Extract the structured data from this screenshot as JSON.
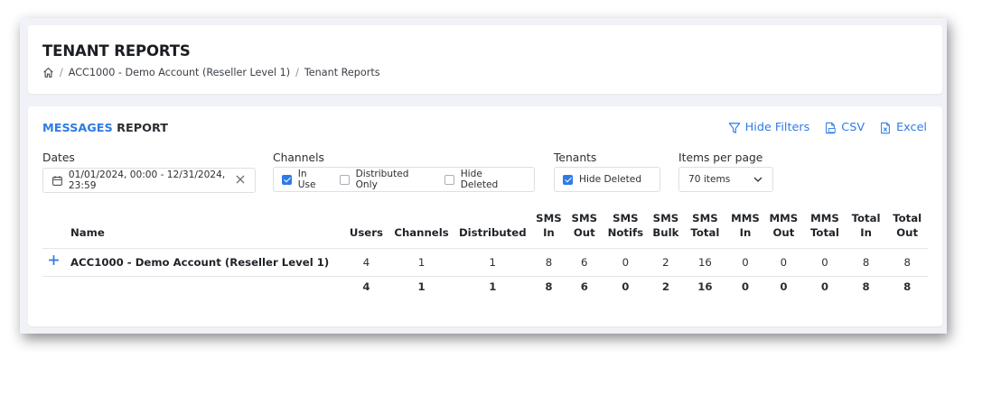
{
  "page": {
    "title": "TENANT REPORTS",
    "breadcrumb": [
      "ACC1000 - Demo Account (Reseller Level 1)",
      "Tenant Reports"
    ]
  },
  "report": {
    "title_accent": "MESSAGES",
    "title_rest": "REPORT",
    "actions": {
      "hide_filters": "Hide Filters",
      "csv": "CSV",
      "excel": "Excel"
    }
  },
  "filters": {
    "dates_label": "Dates",
    "dates_value": "01/01/2024, 00:00 - 12/31/2024, 23:59",
    "channels_label": "Channels",
    "channels_options": [
      {
        "label": "In Use",
        "checked": true
      },
      {
        "label": "Distributed Only",
        "checked": false
      },
      {
        "label": "Hide Deleted",
        "checked": false
      }
    ],
    "tenants_label": "Tenants",
    "tenants_options": [
      {
        "label": "Hide Deleted",
        "checked": true
      }
    ],
    "items_label": "Items per page",
    "items_value": "70 items"
  },
  "table": {
    "columns": [
      [
        "Name"
      ],
      [
        "Users"
      ],
      [
        "Channels"
      ],
      [
        "Distributed"
      ],
      [
        "SMS",
        "In"
      ],
      [
        "SMS",
        "Out"
      ],
      [
        "SMS",
        "Notifs"
      ],
      [
        "SMS",
        "Bulk"
      ],
      [
        "SMS",
        "Total"
      ],
      [
        "MMS",
        "In"
      ],
      [
        "MMS",
        "Out"
      ],
      [
        "MMS",
        "Total"
      ],
      [
        "Total",
        "In"
      ],
      [
        "Total",
        "Out"
      ]
    ],
    "rows": [
      {
        "name": "ACC1000 - Demo Account (Reseller Level 1)",
        "values": [
          "4",
          "1",
          "1",
          "8",
          "6",
          "0",
          "2",
          "16",
          "0",
          "0",
          "0",
          "8",
          "8"
        ]
      }
    ],
    "totals": [
      "4",
      "1",
      "1",
      "8",
      "6",
      "0",
      "2",
      "16",
      "0",
      "0",
      "0",
      "8",
      "8"
    ]
  },
  "colors": {
    "accent": "#2f7be5",
    "background": "#f0f2f7"
  }
}
